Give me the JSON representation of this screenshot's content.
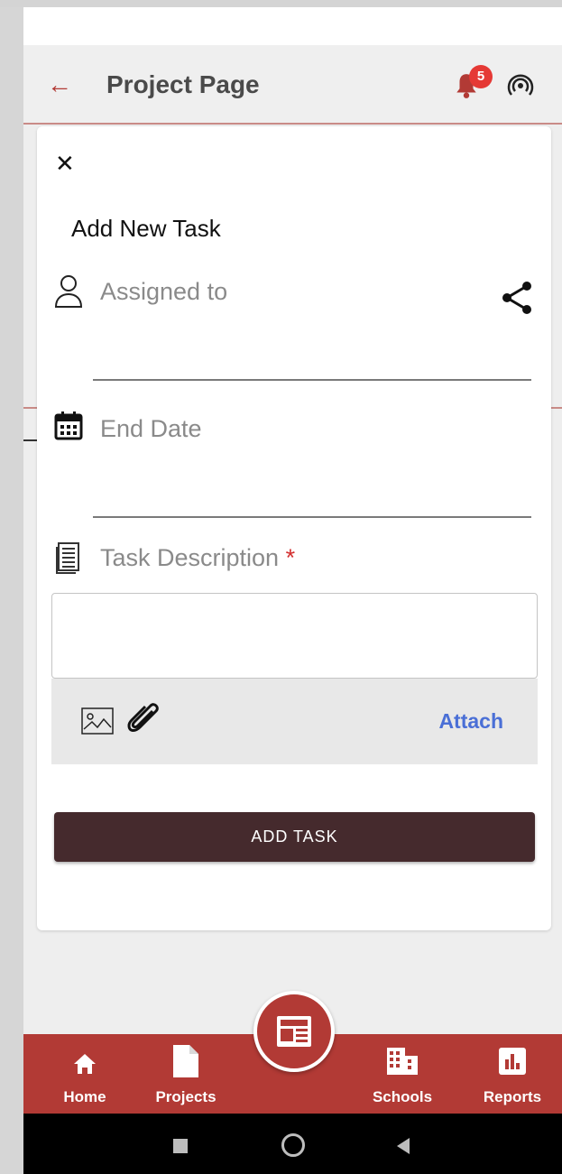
{
  "appbar": {
    "title": "Project Page",
    "notification_count": "5",
    "icons": [
      "back-arrow-icon",
      "bell-icon",
      "broadcast-icon"
    ]
  },
  "dialog": {
    "title": "Add New Task",
    "assigned_label": "Assigned to",
    "end_date_label": "End Date",
    "description_label": "Task Description",
    "required_mark": "*",
    "attach_label": "Attach",
    "submit_label": "ADD TASK"
  },
  "bottom_nav": {
    "items": [
      {
        "label": "Home",
        "icon": "home-icon"
      },
      {
        "label": "Projects",
        "icon": "document-icon"
      },
      {
        "label": "Schools",
        "icon": "building-icon"
      },
      {
        "label": "Reports",
        "icon": "bar-chart-icon"
      }
    ],
    "fab_icon": "newspaper-icon"
  },
  "colors": {
    "primary": "#b23a35",
    "button": "#452a2d",
    "link": "#4a6fd6",
    "badge": "#e53935"
  }
}
